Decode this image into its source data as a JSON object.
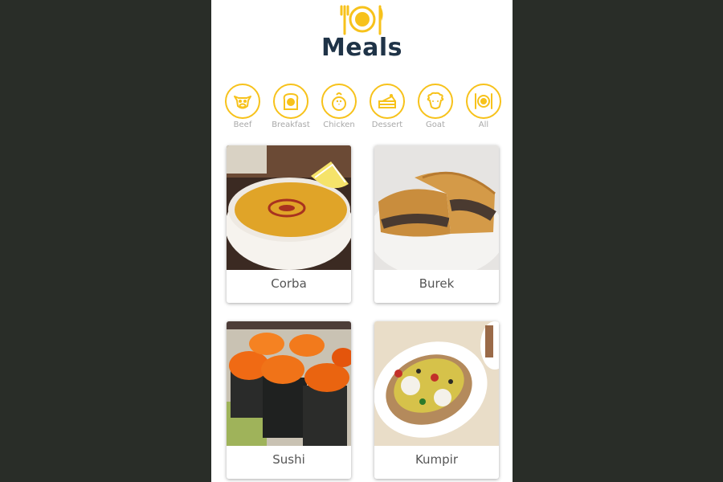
{
  "app": {
    "title": "Meals",
    "logo_icon": "plate-fork-knife-icon",
    "accent_color": "#f7c21b"
  },
  "categories": [
    {
      "label": "Beef",
      "icon": "cow-icon"
    },
    {
      "label": "Breakfast",
      "icon": "toast-egg-icon"
    },
    {
      "label": "Chicken",
      "icon": "chicken-icon"
    },
    {
      "label": "Dessert",
      "icon": "cake-icon"
    },
    {
      "label": "Goat",
      "icon": "goat-icon"
    },
    {
      "label": "All",
      "icon": "plate-fork-knife-icon"
    }
  ],
  "meals": [
    {
      "name": "Corba"
    },
    {
      "name": "Burek"
    },
    {
      "name": "Sushi"
    },
    {
      "name": "Kumpir"
    }
  ]
}
